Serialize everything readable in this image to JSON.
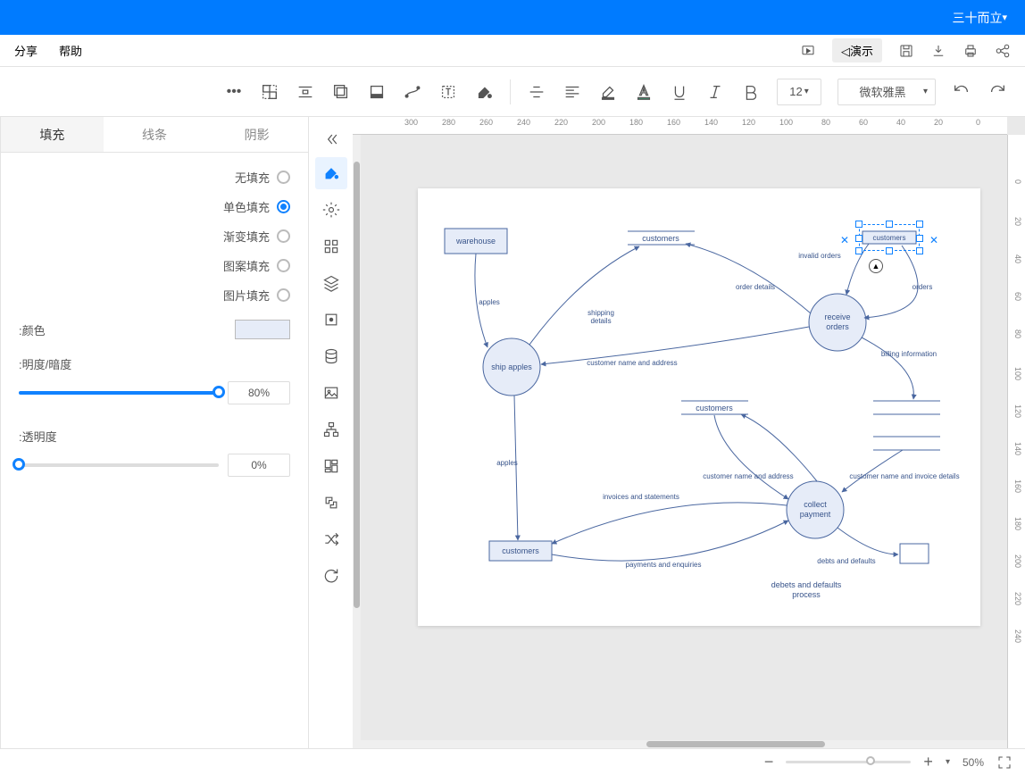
{
  "title": "三十而立",
  "tb1": {
    "share": "分享",
    "help": "帮助",
    "demo": "演示◁"
  },
  "font": {
    "name": "微软雅黑",
    "size": "12"
  },
  "prop": {
    "tab_fill": "填充",
    "tab_line": "线条",
    "tab_shadow": "阴影",
    "r_none": "无填充",
    "r_solid": "单色填充",
    "r_gradient": "渐变填充",
    "r_pattern": "图案填充",
    "r_image": "图片填充",
    "color_label": "颜色:",
    "opacity_label": "明度/暗度:",
    "opacity_val": "80%",
    "trans_label": "透明度:",
    "trans_val": "0%"
  },
  "status": {
    "zoom": "50%"
  },
  "ruler_h": [
    "0",
    "20",
    "40",
    "60",
    "80",
    "100",
    "120",
    "140",
    "160",
    "180",
    "200",
    "220",
    "240",
    "260",
    "280",
    "300"
  ],
  "ruler_v": [
    "0",
    "20",
    "40",
    "60",
    "80",
    "100",
    "120",
    "140",
    "160",
    "180",
    "200",
    "220",
    "240"
  ],
  "diagram": {
    "warehouse": "warehouse",
    "customers1": "customers",
    "customers_sel": "customers",
    "customers_mid": "customers",
    "customers_bot": "customers",
    "ship": "ship apples",
    "receive": "receive\norders",
    "collect": "collect\npayment",
    "debets": "debets and defaults\nprocess",
    "e_apples": "apples",
    "e_ship": "shipping\ndetails",
    "e_orderdet": "order details",
    "e_invalid": "invalid orders",
    "e_orders": "orders",
    "e_billing": "billing information",
    "e_cna1": "customer name and address",
    "e_cna2": "customer name and address",
    "e_cnid": "customer name and invoice details",
    "e_inv": "invoices and statements",
    "e_pay": "payments and enquiries",
    "e_apples2": "apples",
    "e_debts": "debts and defaults"
  }
}
